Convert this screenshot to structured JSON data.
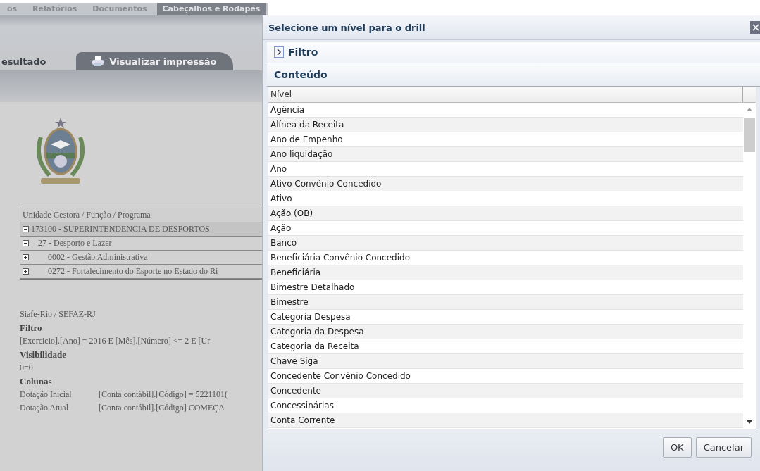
{
  "top_tabs": [
    {
      "label": "os",
      "selected": false
    },
    {
      "label": "Relatórios",
      "selected": false
    },
    {
      "label": "Documentos",
      "selected": false
    },
    {
      "label": "Cabeçalhos e Rodapés",
      "selected": true
    }
  ],
  "view_tabs": [
    {
      "label": "esultado",
      "selected": false,
      "icon": false
    },
    {
      "label": "Visualizar impressão",
      "selected": true,
      "icon": true
    }
  ],
  "tree_table": {
    "header": "Unidade Gestora / Função / Programa",
    "rows": [
      {
        "label": "173100 - SUPERINTENDENCIA DE DESPORTOS",
        "expanded": true,
        "children": [
          {
            "label": "27 - Desporto e Lazer",
            "expanded": true,
            "children": [
              {
                "label": "0002 - Gestão Administrativa",
                "expanded": false
              },
              {
                "label": "0272 - Fortalecimento do Esporte no Estado do Ri",
                "expanded": false
              }
            ]
          }
        ]
      }
    ]
  },
  "report_info": [
    {
      "kind": "text",
      "text": "Siafe-Rio / SEFAZ-RJ"
    },
    {
      "kind": "heading",
      "text": "Filtro"
    },
    {
      "kind": "text",
      "text": "[Exercicio].[Ano] = 2016 E [Mês].[Número] <= 2 E [Ur"
    },
    {
      "kind": "heading",
      "text": "Visibilidade"
    },
    {
      "kind": "text",
      "text": "0=0"
    },
    {
      "kind": "heading",
      "text": "Colunas"
    }
  ],
  "columns": [
    {
      "name": "Dotação Inicial",
      "rule": "[Conta contábil].[Código] = 5221101("
    },
    {
      "name": "Dotação Atual",
      "rule": "[Conta contábil].[Código] COMEÇA"
    }
  ],
  "dialog": {
    "title": "Selecione um nível para o drill",
    "filter_label": "Filtro",
    "filter_expanded": false,
    "content_label": "Conteúdo",
    "column": "Nível",
    "items": [
      {
        "label": "Agência",
        "selected": false
      },
      {
        "label": "Alínea da Receita",
        "selected": false
      },
      {
        "label": "Ano de Empenho",
        "selected": false
      },
      {
        "label": "Ano liquidação",
        "selected": false
      },
      {
        "label": "Ano",
        "selected": false
      },
      {
        "label": "Ativo Convênio Concedido",
        "selected": false
      },
      {
        "label": "Ativo",
        "selected": false
      },
      {
        "label": "Ação (OB)",
        "selected": false
      },
      {
        "label": "Ação",
        "selected": false
      },
      {
        "label": "Banco",
        "selected": false
      },
      {
        "label": "Beneficiária Convênio Concedido",
        "selected": false
      },
      {
        "label": "Beneficiária",
        "selected": false
      },
      {
        "label": "Bimestre Detalhado",
        "selected": false
      },
      {
        "label": "Bimestre",
        "selected": false
      },
      {
        "label": "Categoria Despesa",
        "selected": false
      },
      {
        "label": "Categoria da Despesa",
        "selected": false
      },
      {
        "label": "Categoria da Receita",
        "selected": false
      },
      {
        "label": "Chave Siga",
        "selected": false
      },
      {
        "label": "Concedente Convênio Concedido",
        "selected": false
      },
      {
        "label": "Concedente",
        "selected": false
      },
      {
        "label": "Concessinárias",
        "selected": false
      },
      {
        "label": "Conta Corrente",
        "selected": false
      }
    ],
    "buttons": [
      "OK",
      "Cancelar"
    ]
  }
}
